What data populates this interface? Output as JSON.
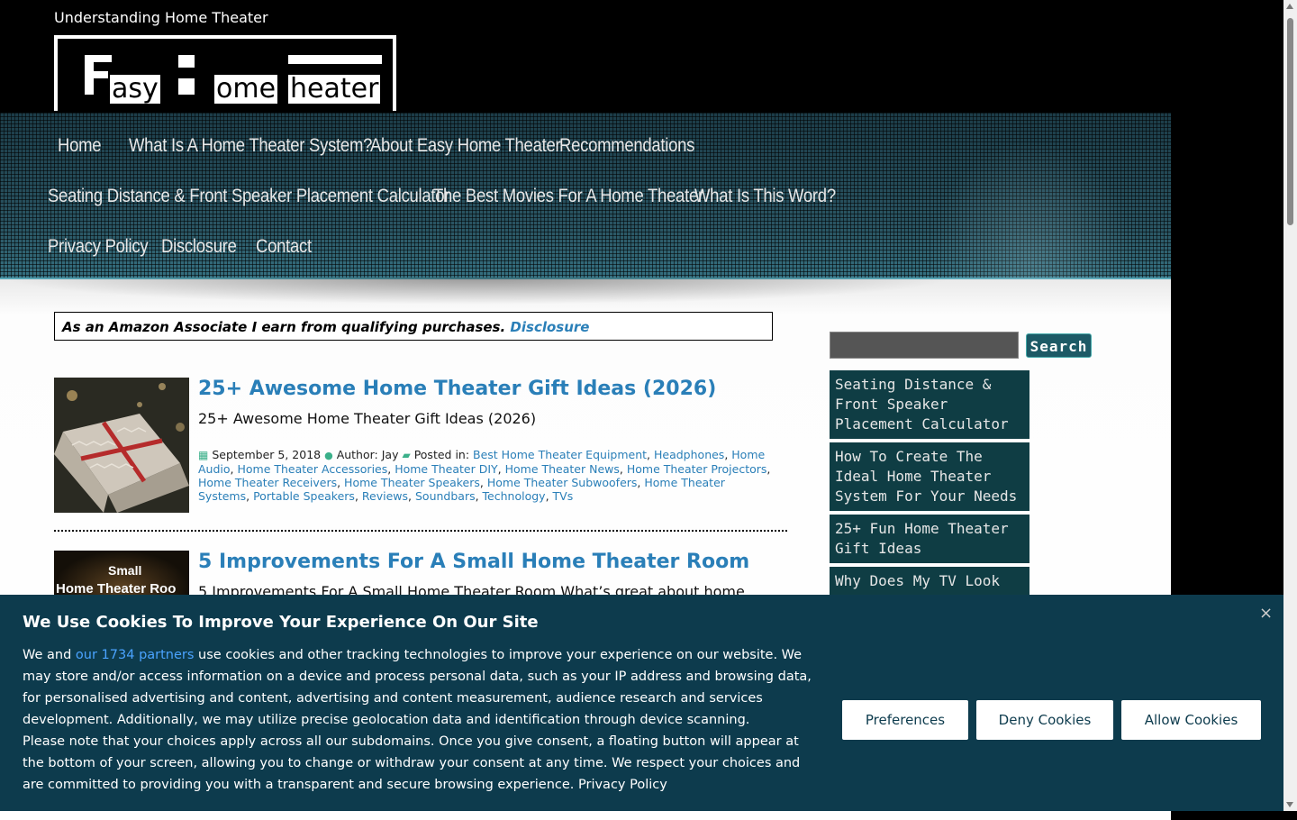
{
  "site": {
    "tagline": "Understanding Home Theater",
    "logo_words": [
      "asy",
      "ome",
      "heater"
    ]
  },
  "nav": {
    "rows": [
      [
        "Home",
        "What Is A Home Theater System?",
        "About Easy Home Theater",
        "Recommendations"
      ],
      [
        "Seating Distance & Front Speaker Placement Calculator",
        "The Best Movies For A Home Theater",
        "What Is This Word?"
      ],
      [
        "Privacy Policy",
        "Disclosure",
        "Contact"
      ]
    ]
  },
  "disclaimer": {
    "text": "As an Amazon Associate I earn from qualifying purchases.",
    "link": "Disclosure"
  },
  "posts": [
    {
      "title": "25+ Awesome Home Theater Gift Ideas (2026)",
      "excerpt": "25+ Awesome Home Theater Gift Ideas (2026)",
      "date": "September 5, 2018",
      "author_label": "Author: Jay",
      "posted_in_label": "Posted in:",
      "categories": [
        "Best Home Theater Equipment",
        "Headphones",
        "Home Audio",
        "Home Theater Accessories",
        "Home Theater DIY",
        "Home Theater News",
        "Home Theater Projectors",
        "Home Theater Receivers",
        "Home Theater Speakers",
        "Home Theater Subwoofers",
        "Home Theater Systems",
        "Portable Speakers",
        "Reviews",
        "Soundbars",
        "Technology",
        "TVs"
      ]
    },
    {
      "title": "5 Improvements For A Small Home Theater Room",
      "excerpt": "5 Improvements For A Small Home Theater Room What’s great about home",
      "thumb_text": [
        "Small",
        "Home Theater Roo"
      ]
    }
  ],
  "sidebar": {
    "search_button": "Search",
    "items": [
      "Seating Distance & Front Speaker Placement Calculator",
      "How To Create The Ideal Home Theater System For Your Needs",
      "25+ Fun Home Theater Gift Ideas",
      "Why Does My TV Look"
    ]
  },
  "cookie": {
    "title": "We Use Cookies To Improve Your Experience On Our Site",
    "text_1": "We and",
    "partners_link": "our 1734 partners",
    "text_2": "use cookies and other tracking technologies to improve your experience on our website. We may store and/or access information on a device and process personal data, such as your IP address and browsing data, for personalised advertising and content, advertising and content measurement, audience research and services development. Additionally, we may utilize precise geolocation data and identification through device scanning.",
    "text_3": "Please note that your choices apply across all our subdomains. Once you give consent, a floating button will appear at the bottom of your screen, allowing you to change or withdraw your consent at any time. We respect your choices and are committed to providing you with a transparent and secure browsing experience.",
    "privacy_link": "Privacy Policy",
    "close": "×",
    "buttons": {
      "preferences": "Preferences",
      "deny": "Deny Cookies",
      "allow": "Allow Cookies"
    }
  },
  "icons": {
    "calendar": "calendar-icon",
    "author": "user-icon",
    "category": "folder-icon"
  },
  "colors": {
    "link": "#2a7fb8",
    "cookie_bg": "#0d3b4d",
    "sidebar_item_bg": "#0f3d44"
  }
}
